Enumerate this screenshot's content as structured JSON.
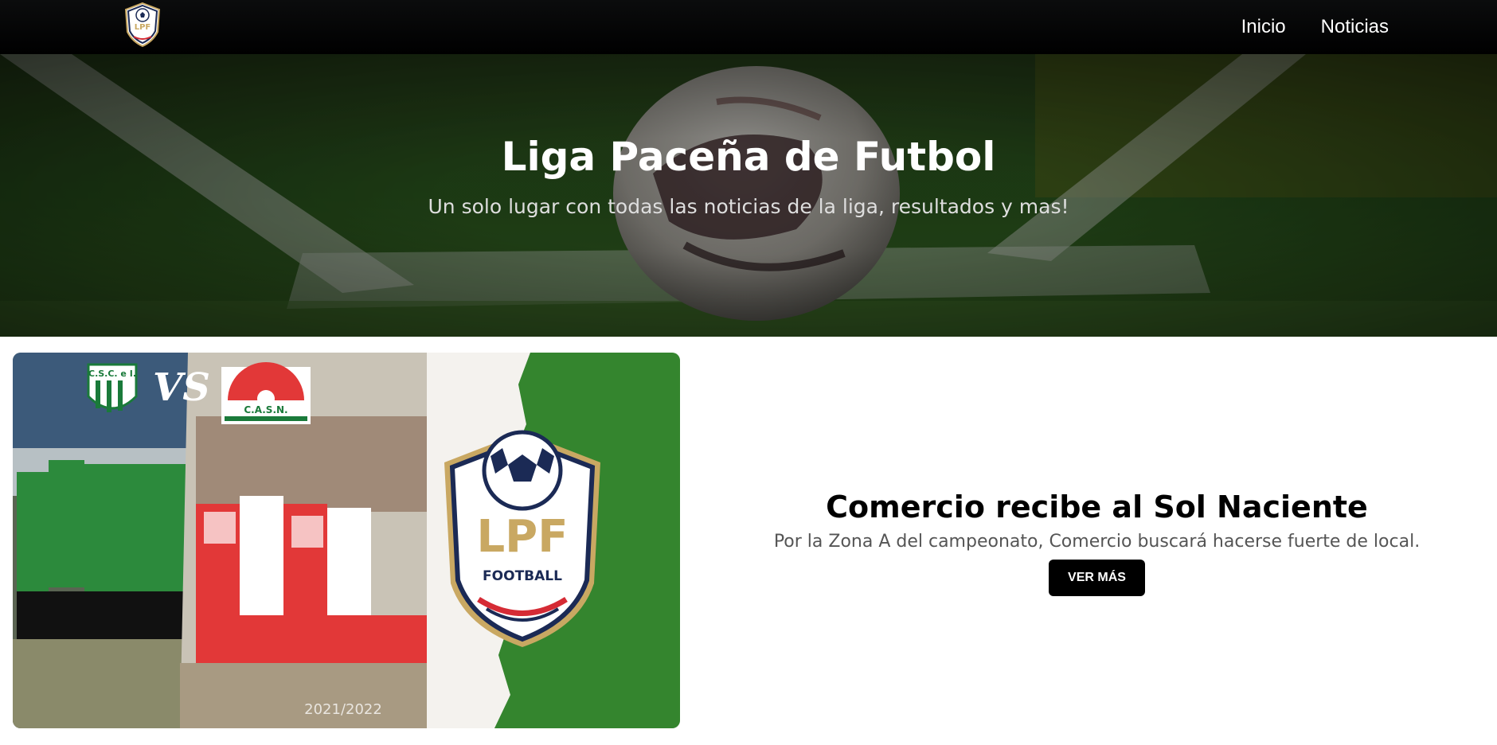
{
  "nav": {
    "logo_alt": "LPF Football",
    "links": [
      {
        "label": "Inicio"
      },
      {
        "label": "Noticias"
      }
    ]
  },
  "hero": {
    "title": "Liga Paceña de Futbol",
    "subtitle": "Un solo lugar con todas las noticias de la liga, resultados y mas!"
  },
  "news": {
    "title": "Comercio recibe al Sol Naciente",
    "description": "Por la Zona A del campeonato, Comercio buscará hacerse fuerte de local.",
    "button_label": "VER MÁS",
    "image": {
      "team_a_badge": "C.S.C. e I.",
      "vs_text": "VS",
      "team_b_badge": "C.A.S.N.",
      "season": "2021/2022",
      "logo_main": "LPF",
      "logo_sub": "FOOTBALL"
    }
  },
  "colors": {
    "navbar": "#000000",
    "accent_gold": "#c9a862",
    "shield_navy": "#1b2a55",
    "shield_red": "#d52b35",
    "grass": "#2f7a2a"
  }
}
